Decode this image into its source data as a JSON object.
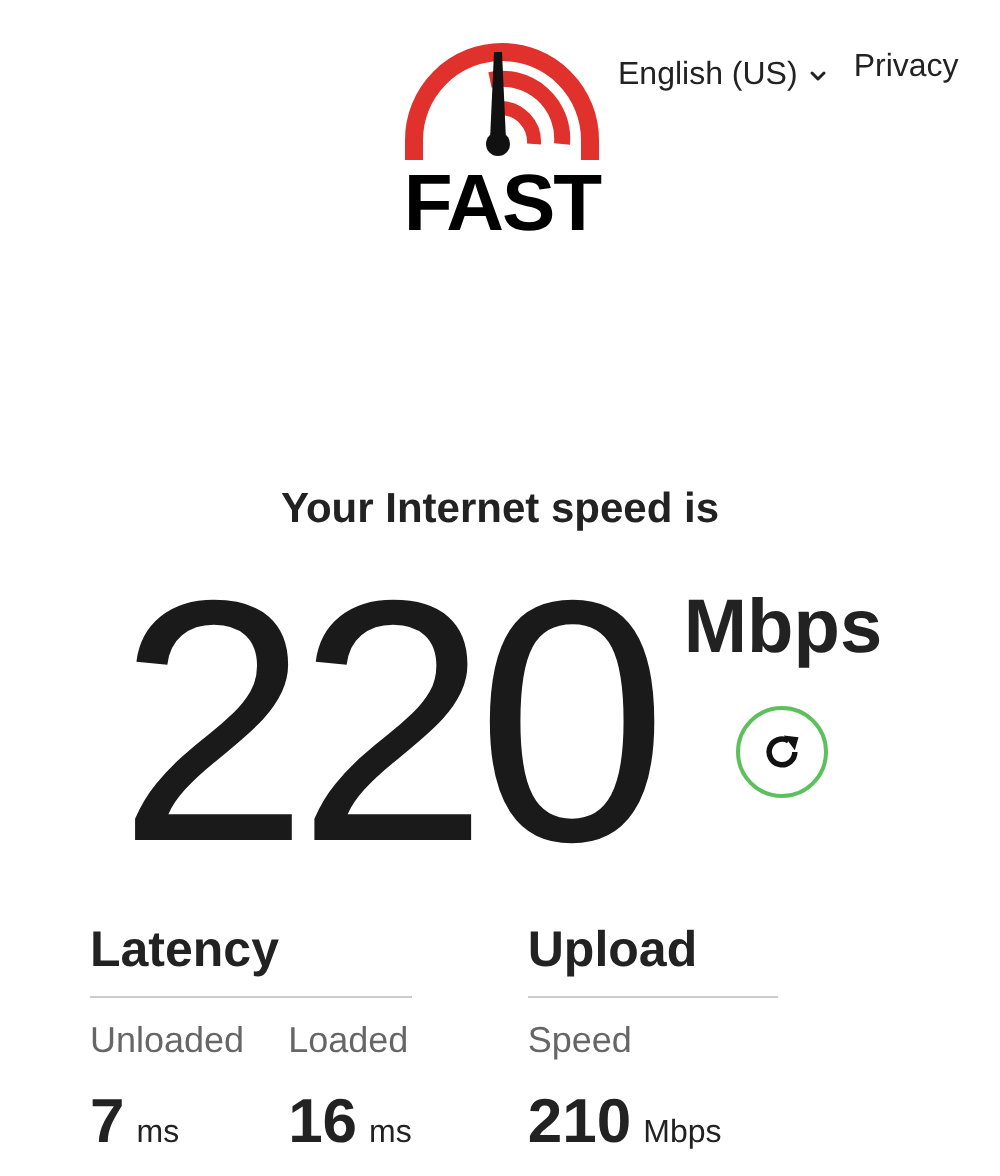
{
  "logo": {
    "text": "FAST"
  },
  "nav": {
    "language": "English (US)",
    "privacy": "Privacy"
  },
  "result": {
    "heading": "Your Internet speed is",
    "value": "220",
    "unit": "Mbps"
  },
  "groups": [
    {
      "title": "Latency",
      "items": [
        {
          "label": "Unloaded",
          "value": "7",
          "unit": "ms"
        },
        {
          "label": "Loaded",
          "value": "16",
          "unit": "ms"
        }
      ]
    },
    {
      "title": "Upload",
      "items": [
        {
          "label": "Speed",
          "value": "210",
          "unit": "Mbps"
        }
      ]
    }
  ]
}
